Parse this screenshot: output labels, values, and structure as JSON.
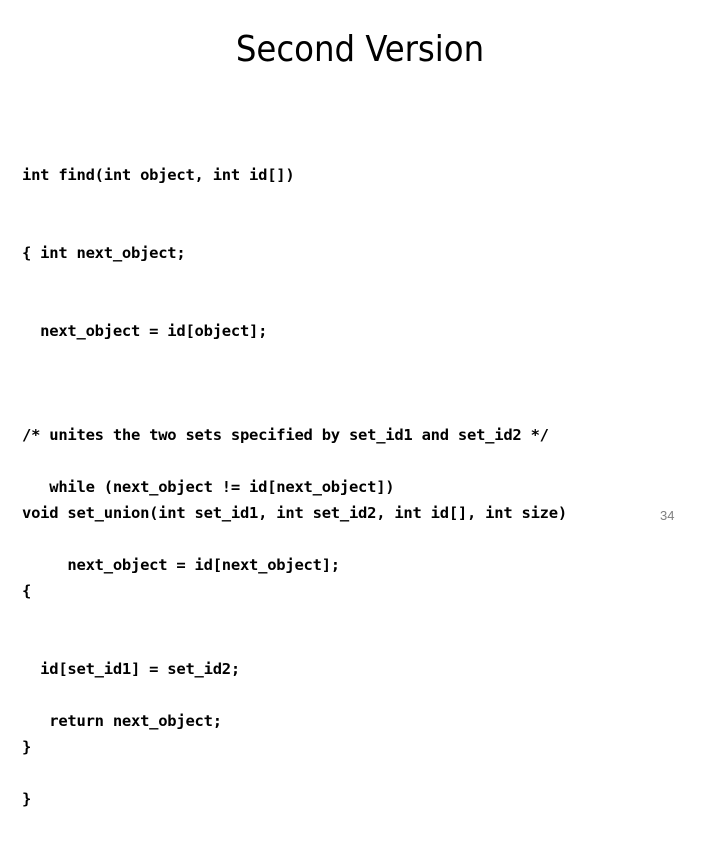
{
  "slide": {
    "title": "Second Version",
    "page_number": "34",
    "background_color": "#ffffff",
    "text_color": "#000000",
    "page_number_color": "#808080"
  },
  "code_blocks": [
    {
      "id": "find-function",
      "lines": [
        "int find(int object, int id[])",
        "{ int next_object;",
        "  next_object = id[object];",
        "",
        "   while (next_object != id[next_object])",
        "     next_object = id[next_object];",
        "",
        "   return next_object;",
        "}"
      ]
    },
    {
      "id": "set-union-function",
      "lines": [
        "/* unites the two sets specified by set_id1 and set_id2 */",
        "void set_union(int set_id1, int set_id2, int id[], int size)",
        "{",
        "  id[set_id1] = set_id2;",
        "}"
      ]
    }
  ]
}
